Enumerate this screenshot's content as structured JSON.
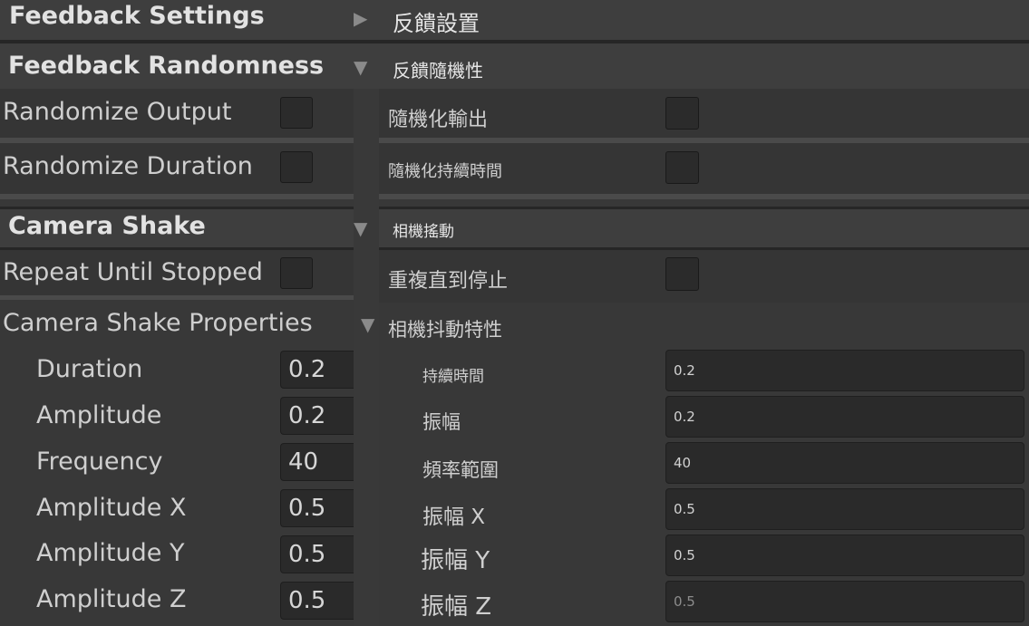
{
  "left": {
    "feedback_settings": "Feedback Settings",
    "feedback_randomness": "Feedback Randomness",
    "randomize_output": "Randomize Output",
    "randomize_duration": "Randomize Duration",
    "camera_shake": "Camera Shake",
    "repeat_until_stopped": "Repeat Until Stopped",
    "camera_shake_properties": "Camera Shake Properties",
    "fields": [
      {
        "label": "Duration",
        "value": "0.2"
      },
      {
        "label": "Amplitude",
        "value": "0.2"
      },
      {
        "label": "Frequency",
        "value": "40"
      },
      {
        "label": "Amplitude X",
        "value": "0.5"
      },
      {
        "label": "Amplitude Y",
        "value": "0.5"
      },
      {
        "label": "Amplitude Z",
        "value": "0.5"
      }
    ]
  },
  "right": {
    "feedback_settings": "反饋設置",
    "feedback_randomness": "反饋隨機性",
    "randomize_output": "隨機化輸出",
    "randomize_duration": "隨機化持續時間",
    "camera_shake": "相機搖動",
    "repeat_until_stopped": "重複直到停止",
    "camera_shake_properties": "相機抖動特性",
    "fields": [
      {
        "label": "持續時間",
        "value": "0.2"
      },
      {
        "label": "振幅",
        "value": "0.2"
      },
      {
        "label": "頻率範圍",
        "value": "40"
      },
      {
        "label": "振幅 X",
        "value": "0.5"
      },
      {
        "label": "振幅 Y",
        "value": "0.5"
      },
      {
        "label": "振幅 Z",
        "value": "0.5"
      }
    ]
  },
  "icons": {
    "collapsed": "triangle-right-icon",
    "expanded": "triangle-down-icon"
  }
}
